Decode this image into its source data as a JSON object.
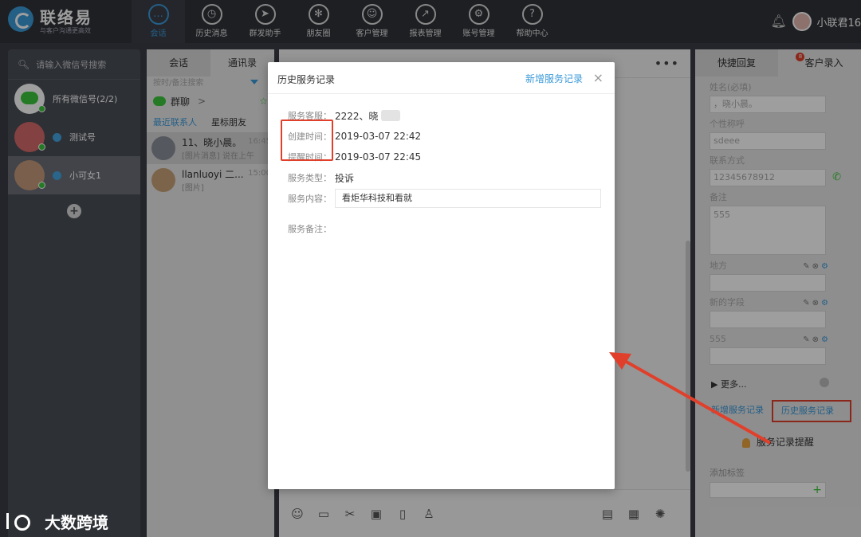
{
  "app": {
    "name": "联络易",
    "slogan": "与客户沟通更高效"
  },
  "nav": [
    {
      "label": "会话",
      "icon": "chat-bubble-icon",
      "glyph": "…",
      "active": true
    },
    {
      "label": "历史消息",
      "icon": "clock-icon",
      "glyph": "◷"
    },
    {
      "label": "群发助手",
      "icon": "paper-plane-icon",
      "glyph": "➤"
    },
    {
      "label": "朋友圈",
      "icon": "aperture-icon",
      "glyph": "✻"
    },
    {
      "label": "客户管理",
      "icon": "customer-icon",
      "glyph": "☺"
    },
    {
      "label": "报表管理",
      "icon": "chart-icon",
      "glyph": "↗"
    },
    {
      "label": "账号管理",
      "icon": "gear-icon",
      "glyph": "⚙"
    },
    {
      "label": "帮助中心",
      "icon": "help-icon",
      "glyph": "?"
    }
  ],
  "user": {
    "name": "小联君16"
  },
  "sidebar": {
    "search_placeholder": "请输入微信号搜索",
    "accounts": [
      {
        "label": "所有微信号(2/2)",
        "color": "#ffffff"
      },
      {
        "label": "测试号",
        "color": "#d66a6a"
      },
      {
        "label": "小可女1",
        "color": "#c49a7b"
      }
    ]
  },
  "middle": {
    "tabs": [
      "会话",
      "通讯录"
    ],
    "filter_label": "按时/备注搜索",
    "group_label": "群聊",
    "subtabs": [
      "最近联系人",
      "星标朋友"
    ],
    "contacts": [
      {
        "name": "11、晓小晨。",
        "sub": "[图片消息]  说在上午",
        "time": "16:45"
      },
      {
        "name": "llanluoyi 二...",
        "sub": "[图片]",
        "time": "15:00"
      }
    ]
  },
  "right": {
    "tabs": [
      "快捷回复",
      "客户录入"
    ],
    "badge": "8",
    "fields": [
      {
        "label": "姓名(必填)",
        "value": "，晓小晨。",
        "type": "input"
      },
      {
        "label": "个性称呼",
        "value": "sdeee",
        "type": "input"
      },
      {
        "label": "联系方式",
        "value": "12345678912",
        "type": "phone"
      },
      {
        "label": "备注",
        "value": "555",
        "type": "textarea"
      },
      {
        "label": "地方",
        "value": "",
        "type": "input",
        "tools": true
      },
      {
        "label": "新的字段",
        "value": "",
        "type": "input",
        "tools": true
      },
      {
        "label": "555",
        "value": "",
        "type": "input",
        "tools": true
      }
    ],
    "more_label": "更多...",
    "new_record": "新增服务记录",
    "history_record": "历史服务记录",
    "reminder": "服务记录提醒",
    "reminder_badge": "8",
    "add_tag": "添加标签"
  },
  "modal": {
    "title": "历史服务记录",
    "new_link": "新增服务记录",
    "close": "×",
    "rows": [
      {
        "key": "服务客服：",
        "value": "2222、晓",
        "blur": true
      },
      {
        "key": "创建时间：",
        "value": "2019-03-07 22:42"
      },
      {
        "key": "提醒时间：",
        "value": "2019-03-07 22:45"
      },
      {
        "key": "服务类型：",
        "value": "投诉"
      },
      {
        "key": "服务内容：",
        "value": "看炬华科技和看就",
        "box": true
      },
      {
        "key": "服务备注：",
        "value": ""
      }
    ]
  },
  "watermark": "大数跨境",
  "colors": {
    "accent": "#3b9ad9",
    "highlight": "#e0402b",
    "online": "#3cc63c"
  }
}
